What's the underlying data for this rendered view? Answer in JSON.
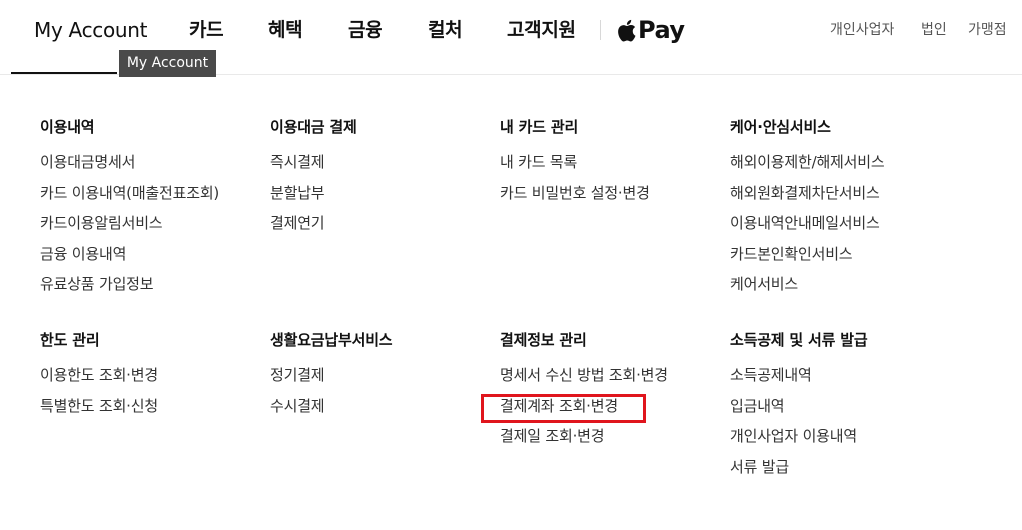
{
  "nav": {
    "my_account": "My Account",
    "tabs": [
      "카드",
      "혜택",
      "금융",
      "컬처",
      "고객지원"
    ],
    "apple_pay_text": "Pay",
    "util_links": [
      "개인사업자",
      "법인",
      "가맹점"
    ],
    "tooltip": "My Account"
  },
  "menu": {
    "row1": [
      {
        "title": "이용내역",
        "items": [
          "이용대금명세서",
          "카드 이용내역(매출전표조회)",
          "카드이용알림서비스",
          "금융 이용내역",
          "유료상품 가입정보"
        ]
      },
      {
        "title": "이용대금 결제",
        "items": [
          "즉시결제",
          "분할납부",
          "결제연기"
        ]
      },
      {
        "title": "내 카드 관리",
        "items": [
          "내 카드 목록",
          "카드 비밀번호 설정·변경"
        ]
      },
      {
        "title": "케어·안심서비스",
        "items": [
          "해외이용제한/해제서비스",
          "해외원화결제차단서비스",
          "이용내역안내메일서비스",
          "카드본인확인서비스",
          "케어서비스"
        ]
      }
    ],
    "row2": [
      {
        "title": "한도 관리",
        "items": [
          "이용한도 조회·변경",
          "특별한도 조회·신청"
        ]
      },
      {
        "title": "생활요금납부서비스",
        "items": [
          "정기결제",
          "수시결제"
        ]
      },
      {
        "title": "결제정보 관리",
        "items": [
          "명세서 수신 방법 조회·변경",
          "결제계좌 조회·변경",
          "결제일 조회·변경"
        ]
      },
      {
        "title": "소득공제 및 서류 발급",
        "items": [
          "소득공제내역",
          "입금내역",
          "개인사업자 이용내역",
          "서류 발급"
        ]
      }
    ]
  },
  "colors": {
    "highlight": "#e0151d",
    "tooltip_bg": "#4a4a4a"
  },
  "icons": {
    "brand": "apple-icon"
  }
}
